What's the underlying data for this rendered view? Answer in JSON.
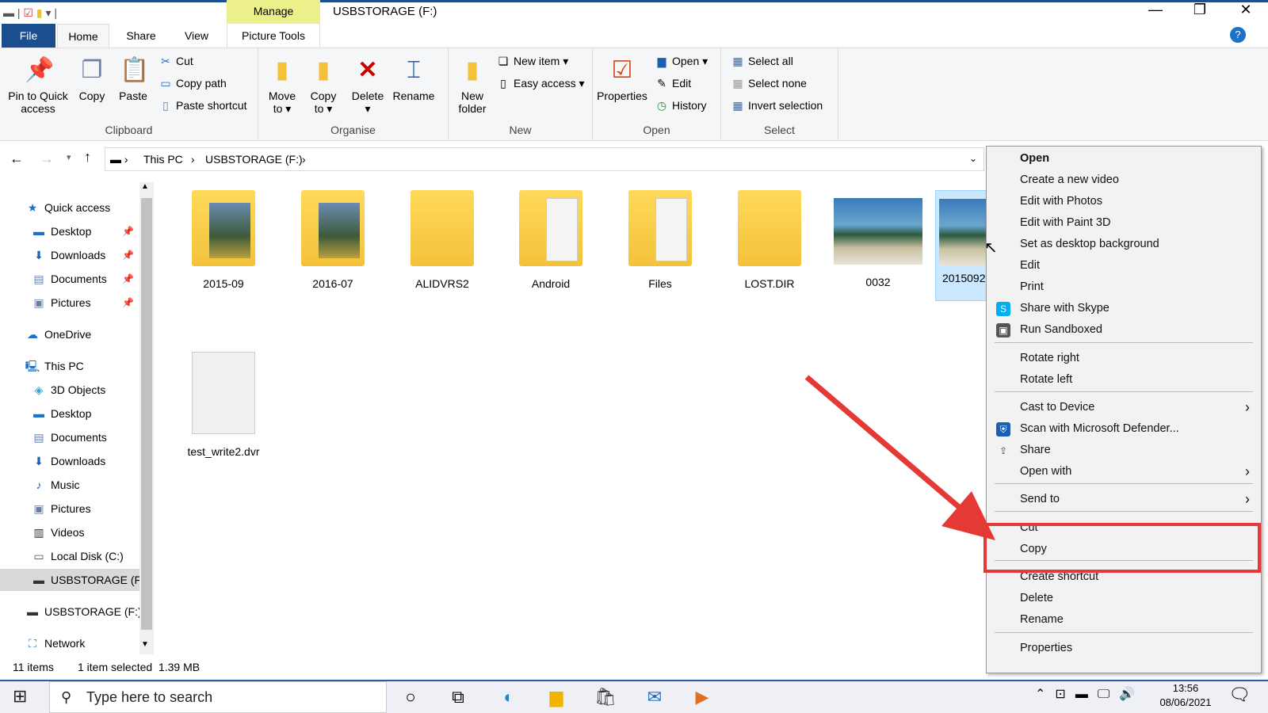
{
  "window": {
    "title": "USBSTORAGE (F:)",
    "context_tab": "Manage",
    "minimize": "—",
    "restore": "❐",
    "close": "✕"
  },
  "tabs": [
    {
      "label": "File"
    },
    {
      "label": "Home"
    },
    {
      "label": "Share"
    },
    {
      "label": "View"
    },
    {
      "label": "Picture Tools"
    }
  ],
  "ribbon": {
    "clipboard": {
      "label": "Clipboard",
      "pin": "Pin to Quick access",
      "copy": "Copy",
      "paste": "Paste",
      "cut": "Cut",
      "copy_path": "Copy path",
      "paste_shortcut": "Paste shortcut"
    },
    "organise": {
      "label": "Organise",
      "move_to": "Move to ▾",
      "copy_to": "Copy to ▾",
      "delete": "Delete",
      "rename": "Rename"
    },
    "new": {
      "label": "New",
      "new_folder": "New folder",
      "new_item": "New item ▾",
      "easy_access": "Easy access ▾"
    },
    "open": {
      "label": "Open",
      "properties": "Properties",
      "open": "Open ▾",
      "edit": "Edit",
      "history": "History"
    },
    "select": {
      "label": "Select",
      "select_all": "Select all",
      "select_none": "Select none",
      "invert_selection": "Invert selection"
    }
  },
  "address": {
    "crumbs": [
      "This PC",
      "USBSTORAGE (F:)"
    ]
  },
  "nav": [
    {
      "label": "Quick access",
      "icon": "star-icon"
    },
    {
      "label": "Desktop",
      "icon": "desktop-icon",
      "pinned": true
    },
    {
      "label": "Downloads",
      "icon": "download-icon",
      "pinned": true
    },
    {
      "label": "Documents",
      "icon": "documents-icon",
      "pinned": true
    },
    {
      "label": "Pictures",
      "icon": "pictures-icon",
      "pinned": true
    },
    {
      "label": "OneDrive",
      "icon": "cloud-icon"
    },
    {
      "label": "This PC",
      "icon": "computer-icon"
    },
    {
      "label": "3D Objects",
      "icon": "cube-icon"
    },
    {
      "label": "Desktop",
      "icon": "desktop-icon"
    },
    {
      "label": "Documents",
      "icon": "documents-icon"
    },
    {
      "label": "Downloads",
      "icon": "download-icon"
    },
    {
      "label": "Music",
      "icon": "music-icon"
    },
    {
      "label": "Pictures",
      "icon": "pictures-icon"
    },
    {
      "label": "Videos",
      "icon": "videos-icon"
    },
    {
      "label": "Local Disk (C:)",
      "icon": "disk-icon"
    },
    {
      "label": "USBSTORAGE (F:",
      "icon": "usb-drive-icon",
      "selected": true
    },
    {
      "label": "USBSTORAGE (F:)",
      "icon": "usb-drive-icon"
    },
    {
      "label": "Network",
      "icon": "network-icon"
    }
  ],
  "files": [
    {
      "name": "2015-09",
      "type": "folder-photo"
    },
    {
      "name": "2016-07",
      "type": "folder-photo"
    },
    {
      "name": "ALIDVRS2",
      "type": "folder"
    },
    {
      "name": "Android",
      "type": "folder-docs"
    },
    {
      "name": "Files",
      "type": "folder-docs"
    },
    {
      "name": "LOST.DIR",
      "type": "folder"
    },
    {
      "name": "0032",
      "type": "image"
    },
    {
      "name": "2015092",
      "type": "image",
      "selected": true
    },
    {
      "name": "test_write2.dvr",
      "type": "file"
    }
  ],
  "status": {
    "count": "11 items",
    "selection": "1 item selected  1.39 MB"
  },
  "context_menu": {
    "items": [
      {
        "label": "Open",
        "bold": true
      },
      {
        "label": "Create a new video"
      },
      {
        "label": "Edit with Photos"
      },
      {
        "label": "Edit with Paint 3D"
      },
      {
        "label": "Set as desktop background"
      },
      {
        "label": "Edit"
      },
      {
        "label": "Print"
      },
      {
        "label": "Share with Skype",
        "icon": "skype-icon"
      },
      {
        "label": "Run Sandboxed",
        "icon": "sandbox-icon"
      },
      {
        "label": "Rotate right"
      },
      {
        "label": "Rotate left"
      },
      {
        "label": "Cast to Device",
        "submenu": true
      },
      {
        "label": "Scan with Microsoft Defender...",
        "icon": "defender-icon"
      },
      {
        "label": "Share",
        "icon": "share-icon"
      },
      {
        "label": "Open with",
        "submenu": true
      },
      {
        "label": "Send to",
        "submenu": true
      },
      {
        "label": "Cut",
        "highlighted": true
      },
      {
        "label": "Copy",
        "highlighted": true
      },
      {
        "label": "Create shortcut"
      },
      {
        "label": "Delete"
      },
      {
        "label": "Rename"
      },
      {
        "label": "Properties"
      }
    ]
  },
  "annotation": {
    "color": "#e53935"
  },
  "taskbar": {
    "search_placeholder": "Type here to search",
    "time": "13:56",
    "date": "08/06/2021"
  }
}
